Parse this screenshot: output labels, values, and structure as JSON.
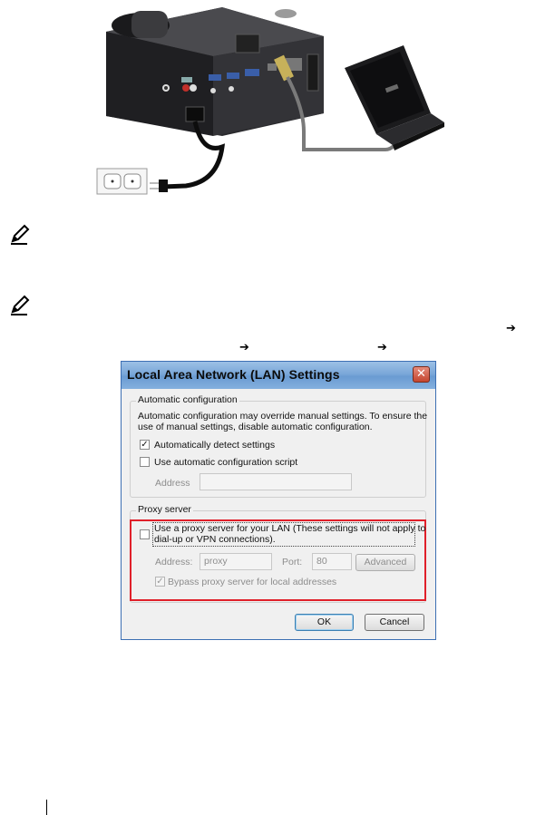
{
  "figure_top": {
    "alt_icon": "projector-laptop-connection-illustration"
  },
  "arrows": {
    "glyph": "➔"
  },
  "dialog": {
    "title": "Local Area Network (LAN) Settings",
    "close_glyph": "✕",
    "auto_config": {
      "legend": "Automatic configuration",
      "description_line1": "Automatic configuration may override manual settings.  To ensure the",
      "description_line2": "use of manual settings, disable automatic configuration.",
      "auto_detect_label": "Automatically detect settings",
      "auto_detect_checked": true,
      "use_script_label": "Use automatic configuration script",
      "use_script_checked": false,
      "address_label": "Address",
      "address_value": ""
    },
    "proxy": {
      "legend": "Proxy server",
      "use_proxy_line1": "Use a proxy server for your LAN (These settings will not apply to",
      "use_proxy_line2": "dial-up or VPN connections).",
      "use_proxy_checked": false,
      "address_label": "Address:",
      "address_value": "proxy",
      "port_label": "Port:",
      "port_value": "80",
      "advanced_label": "Advanced",
      "bypass_label": "Bypass proxy server for local addresses",
      "bypass_checked": true
    },
    "ok_label": "OK",
    "cancel_label": "Cancel"
  },
  "colors": {
    "highlight": "#e0202a",
    "titlebar": "#7aa7d8"
  }
}
